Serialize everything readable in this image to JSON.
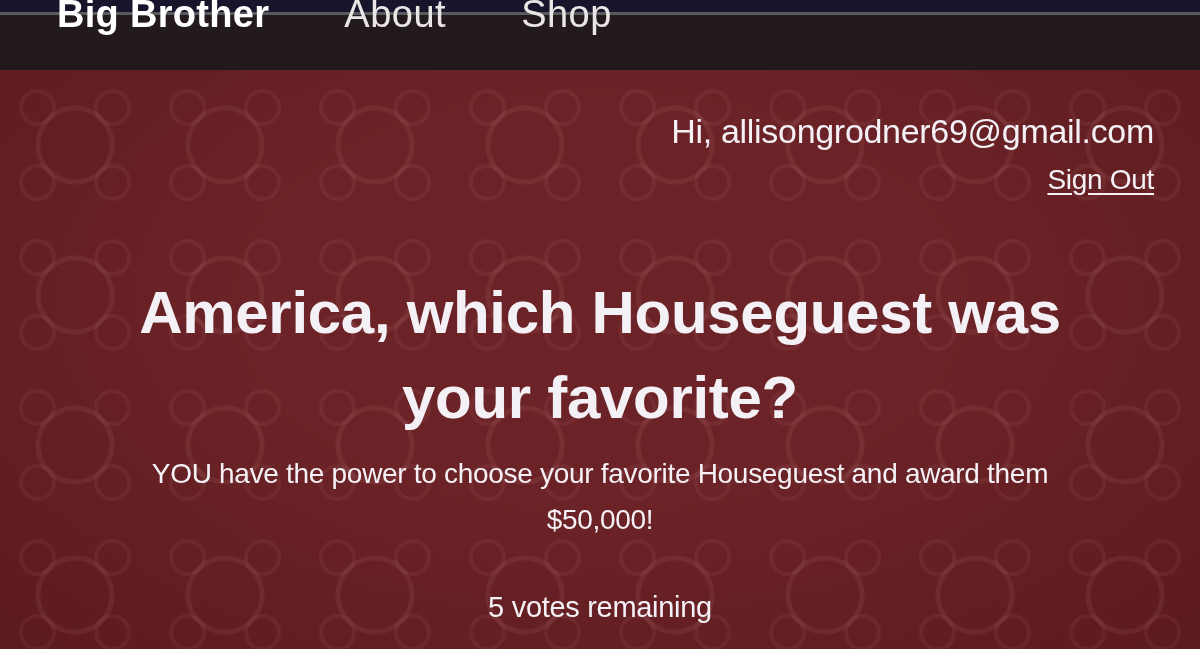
{
  "nav": {
    "brand": "Big Brother",
    "links": [
      {
        "label": "About"
      },
      {
        "label": "Shop"
      }
    ]
  },
  "account": {
    "greeting": "Hi, allisongrodner69@gmail.com",
    "sign_out": "Sign Out"
  },
  "poll": {
    "heading": "America, which Houseguest was your favorite?",
    "subtitle": "YOU have the power to choose your favorite Houseguest and award them $50,000!",
    "votes_remaining": "5 votes remaining"
  }
}
